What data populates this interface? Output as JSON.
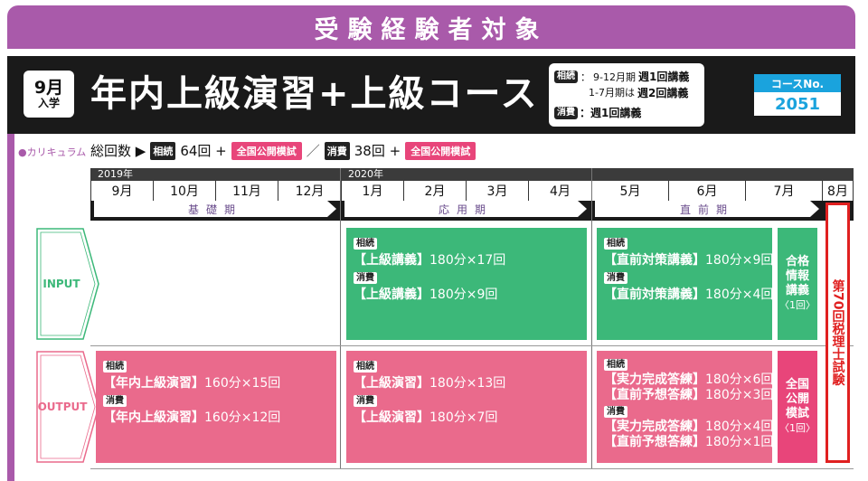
{
  "banner": {
    "text": "受験経験者対象"
  },
  "header": {
    "month_big": "9月",
    "month_small": "入学",
    "title": "年内上級演習+上級コース",
    "schedule": {
      "tag_sokuzoku": "相続",
      "period1": "9-12月期",
      "weekly1": "週1回講義",
      "period2": "1-7月期は",
      "weekly2": "週2回講義",
      "tag_shohi": "消費",
      "weekly3": "：週1回講義"
    },
    "course_no_label": "コースNo.",
    "course_no_value": "2051"
  },
  "curriculum": {
    "label": "●カリキュラム",
    "total": "総回数 ▶",
    "tag1": "相続",
    "count1": "64回 +",
    "mock1": "全国公開模試",
    "slash": "／",
    "tag2": "消費",
    "count2": "38回 +",
    "mock2": "全国公開模試"
  },
  "timeline": {
    "year1": "2019年",
    "year2": "2020年",
    "months": [
      "9月",
      "10月",
      "11月",
      "12月",
      "1月",
      "2月",
      "3月",
      "4月",
      "5月",
      "6月",
      "7月",
      "8月"
    ],
    "phases": [
      "基礎期",
      "応用期",
      "直前期"
    ]
  },
  "rows": {
    "input": "INPUT",
    "output": "OUTPUT"
  },
  "input_blocks": {
    "apply": {
      "tag1": "相続",
      "line1_name": "【上級講義】",
      "line1_rest": "180分×17回",
      "tag2": "消費",
      "line2_name": "【上級講義】",
      "line2_rest": "180分×9回"
    },
    "final": {
      "tag1": "相続",
      "line1_name": "【直前対策講義】",
      "line1_rest": "180分×9回",
      "tag2": "消費",
      "line2_name": "【直前対策講義】",
      "line2_rest": "180分×4回"
    },
    "pass_info": {
      "l1": "合格",
      "l2": "情報",
      "l3": "講義",
      "sub": "〈1回〉"
    }
  },
  "output_blocks": {
    "basic": {
      "tag1": "相続",
      "line1_name": "【年内上級演習】",
      "line1_rest": "160分×15回",
      "tag2": "消費",
      "line2_name": "【年内上級演習】",
      "line2_rest": "160分×12回"
    },
    "apply": {
      "tag1": "相続",
      "line1_name": "【上級演習】",
      "line1_rest": "180分×13回",
      "tag2": "消費",
      "line2_name": "【上級演習】",
      "line2_rest": "180分×7回"
    },
    "final": {
      "tag1": "相続",
      "a_name": "【実力完成答練】",
      "a_rest": "180分×6回",
      "b_name": "【直前予想答練】",
      "b_rest": "180分×3回",
      "tag2": "消費",
      "c_name": "【実力完成答練】",
      "c_rest": "180分×4回",
      "d_name": "【直前予想答練】",
      "d_rest": "180分×1回"
    },
    "mock": {
      "l1": "全国",
      "l2": "公開",
      "l3": "模試",
      "sub": "〈1回〉"
    }
  },
  "exam": {
    "text": "第70回税理士試験"
  },
  "colors": {
    "purple": "#a95aaa",
    "green": "#3cb879",
    "pink": "#ea6a8c",
    "blue": "#1aa3dd",
    "red": "#e02020"
  }
}
